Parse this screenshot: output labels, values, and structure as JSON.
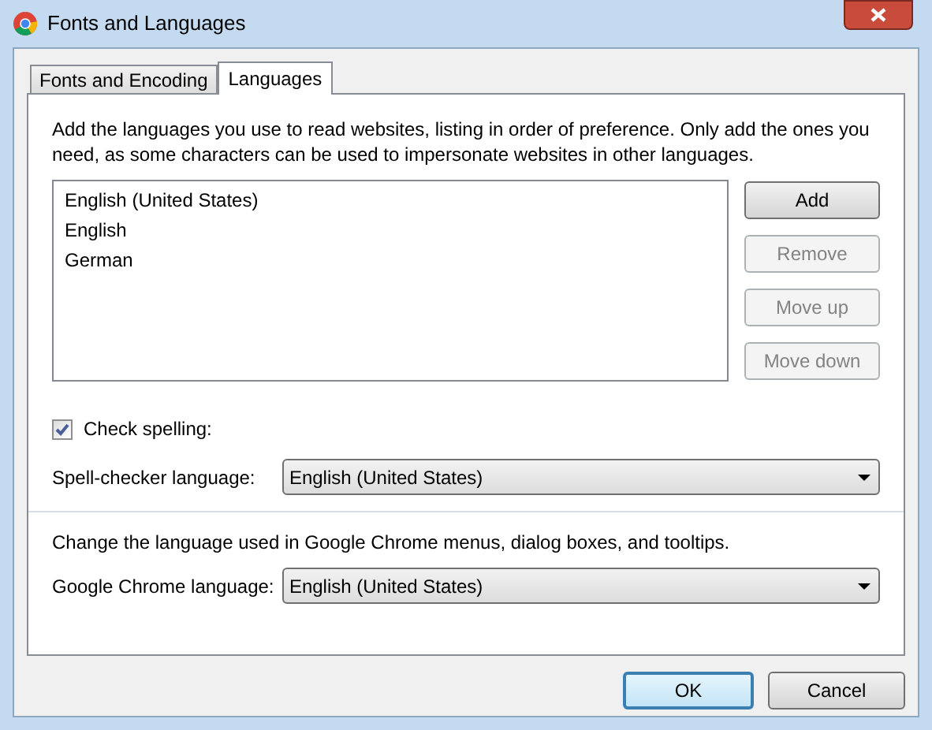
{
  "window": {
    "title": "Fonts and Languages"
  },
  "tabs": [
    {
      "label": "Fonts and Encoding",
      "selected": false
    },
    {
      "label": "Languages",
      "selected": true
    }
  ],
  "description": "Add the languages you use to read websites, listing in order of preference. Only add the ones you need, as some characters can be used to impersonate websites in other languages.",
  "languages": [
    "English (United States)",
    "English",
    "German"
  ],
  "list_buttons": [
    {
      "label": "Add",
      "disabled": false
    },
    {
      "label": "Remove",
      "disabled": true
    },
    {
      "label": "Move up",
      "disabled": true
    },
    {
      "label": "Move down",
      "disabled": true
    }
  ],
  "check_spelling": {
    "label": "Check spelling:",
    "checked": true
  },
  "spell_checker": {
    "label": "Spell-checker language:",
    "value": "English (United States)"
  },
  "chrome_language_note": "Change the language used in Google Chrome menus, dialog boxes, and tooltips.",
  "chrome_language": {
    "label": "Google Chrome language:",
    "value": "English (United States)"
  },
  "buttons": [
    {
      "label": "OK",
      "default": true
    },
    {
      "label": "Cancel",
      "default": false
    }
  ]
}
